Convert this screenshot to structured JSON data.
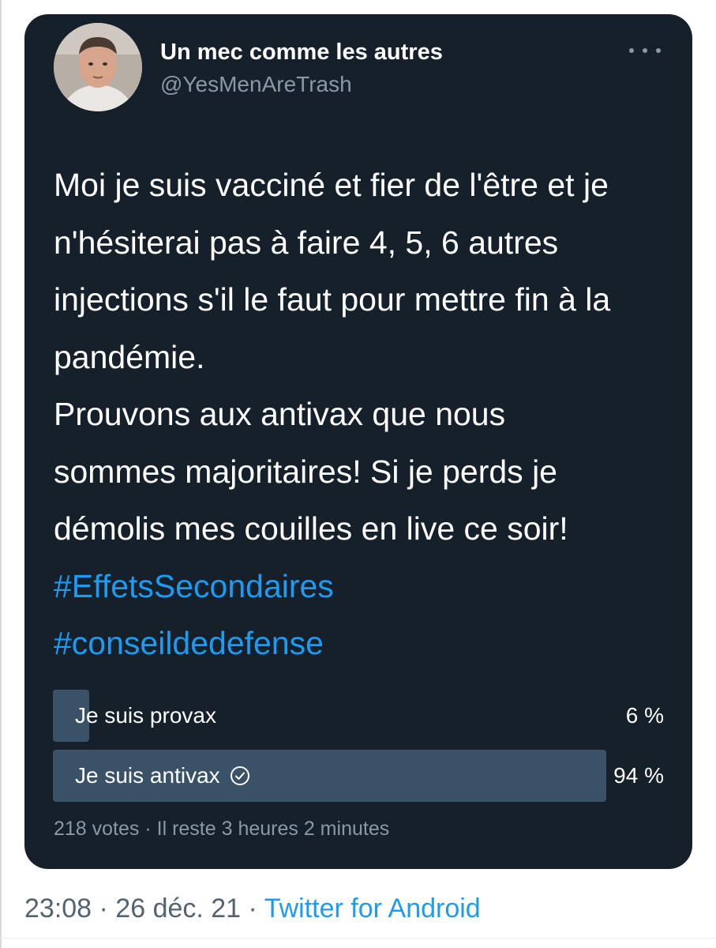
{
  "tweet": {
    "author_name": "Un mec comme les autres",
    "author_handle": "@YesMenAreTrash",
    "text_lines": [
      "Moi je suis vacciné et fier de l'être et je",
      "n'hésiterai pas à faire 4, 5, 6 autres",
      "injections s'il le faut pour mettre fin à la",
      "pandémie.",
      "Prouvons aux antivax que nous",
      "sommes majoritaires! Si je perds je",
      "démolis mes couilles en live ce soir!"
    ],
    "hashtags": [
      "#EffetsSecondaires",
      "#conseildedefense"
    ]
  },
  "poll": {
    "options": [
      {
        "label": "Je suis provax",
        "percent_text": "6 %",
        "percent": 6,
        "selected": false
      },
      {
        "label": "Je suis antivax",
        "percent_text": "94 %",
        "percent": 94,
        "selected": true
      }
    ],
    "meta": "218 votes · Il reste 3 heures 2 minutes"
  },
  "footer": {
    "time_date": "23:08 · 26 déc. 21 · ",
    "source": "Twitter for Android"
  },
  "colors": {
    "card_bg": "#16202b",
    "poll_fill": "#3a5268",
    "link": "#1d9bf0",
    "muted": "#8b98a5"
  },
  "icons": [
    "more-icon",
    "check-circle-icon"
  ]
}
